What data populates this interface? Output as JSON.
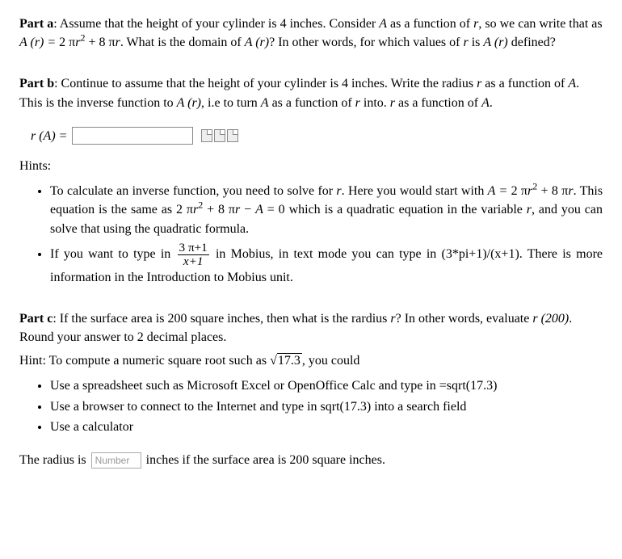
{
  "partA": {
    "label": "Part a",
    "text_before_eq": ": Assume that the height of your cylinder is 4 inches. Consider ",
    "A": "A",
    "text_fn_of": " as a function of ",
    "r": "r",
    "text_write": ", so we can write that as ",
    "eq_lhs": "A (r) = ",
    "eq_rhs_1": "2 π",
    "eq_rhs_r": "r",
    "eq_exp": "2",
    "eq_rhs_2": " + 8 π",
    "text_domain_q": ". What is the domain of ",
    "Ar": "A (r)",
    "text_domain_q2": "? In other words, for which values of ",
    "text_defined": " is ",
    "text_defined2": " defined?"
  },
  "partB": {
    "label": "Part b",
    "text1": ": Continue to assume that the height of your cylinder is 4 inches. Write the radius ",
    "r": "r",
    "text2": " as a function of ",
    "A": "A",
    "text3": ". This is the inverse function to ",
    "Ar": "A (r)",
    "text4": ", i.e to turn ",
    "text5": " as a function of ",
    "text6": " into. ",
    "text7": " as a function of ",
    "period": ".",
    "input_label": "r (A) = "
  },
  "hints": {
    "label": "Hints:",
    "item1_a": "To calculate an inverse function, you need to solve for ",
    "r": "r",
    "item1_b": ". Here you would start with ",
    "eq1_lhs": "A = ",
    "eq1_1": "2 π",
    "eq1_r": "r",
    "eq1_exp": "2",
    "eq1_2": " + 8 π",
    "item1_c": ". This equation is the same as ",
    "eq2_1": "2 π",
    "eq2_2": " + 8 π",
    "eq2_3": " − ",
    "eq2_A": "A",
    "eq2_4": " = 0",
    "item1_d": " which is a quadratic equation in the variable ",
    "item1_e": ", and you can solve that using the quadratic formula.",
    "item2_a": "If you want to type in ",
    "frac_num_1": "3 π+1",
    "frac_den_1": "x+1",
    "item2_b": " in Mobius, in text mode you can type in (3*pi+1)/(x+1). There is more information in the Introduction to Mobius unit."
  },
  "partC": {
    "label": "Part c",
    "text1": ": If the surface area is 200 square inches, then what is the rardius ",
    "r": "r",
    "text2": "? In other words, evaluate ",
    "r200": "r (200)",
    "text3": ". Round your answer to 2 decimal places.",
    "hint_a": "Hint: To compute a numeric square root such as ",
    "sqrt_val": "17.3",
    "hint_b": ", you could",
    "bullet1": "Use a spreadsheet such as Microsoft Excel or OpenOffice Calc and type in =sqrt(17.3)",
    "bullet2": "Use a browser to connect to the Internet and type in sqrt(17.3) into a search field",
    "bullet3": "Use a calculator",
    "answer_a": "The radius is",
    "answer_placeholder": "Number",
    "answer_b": "inches if the surface area is 200 square inches."
  }
}
